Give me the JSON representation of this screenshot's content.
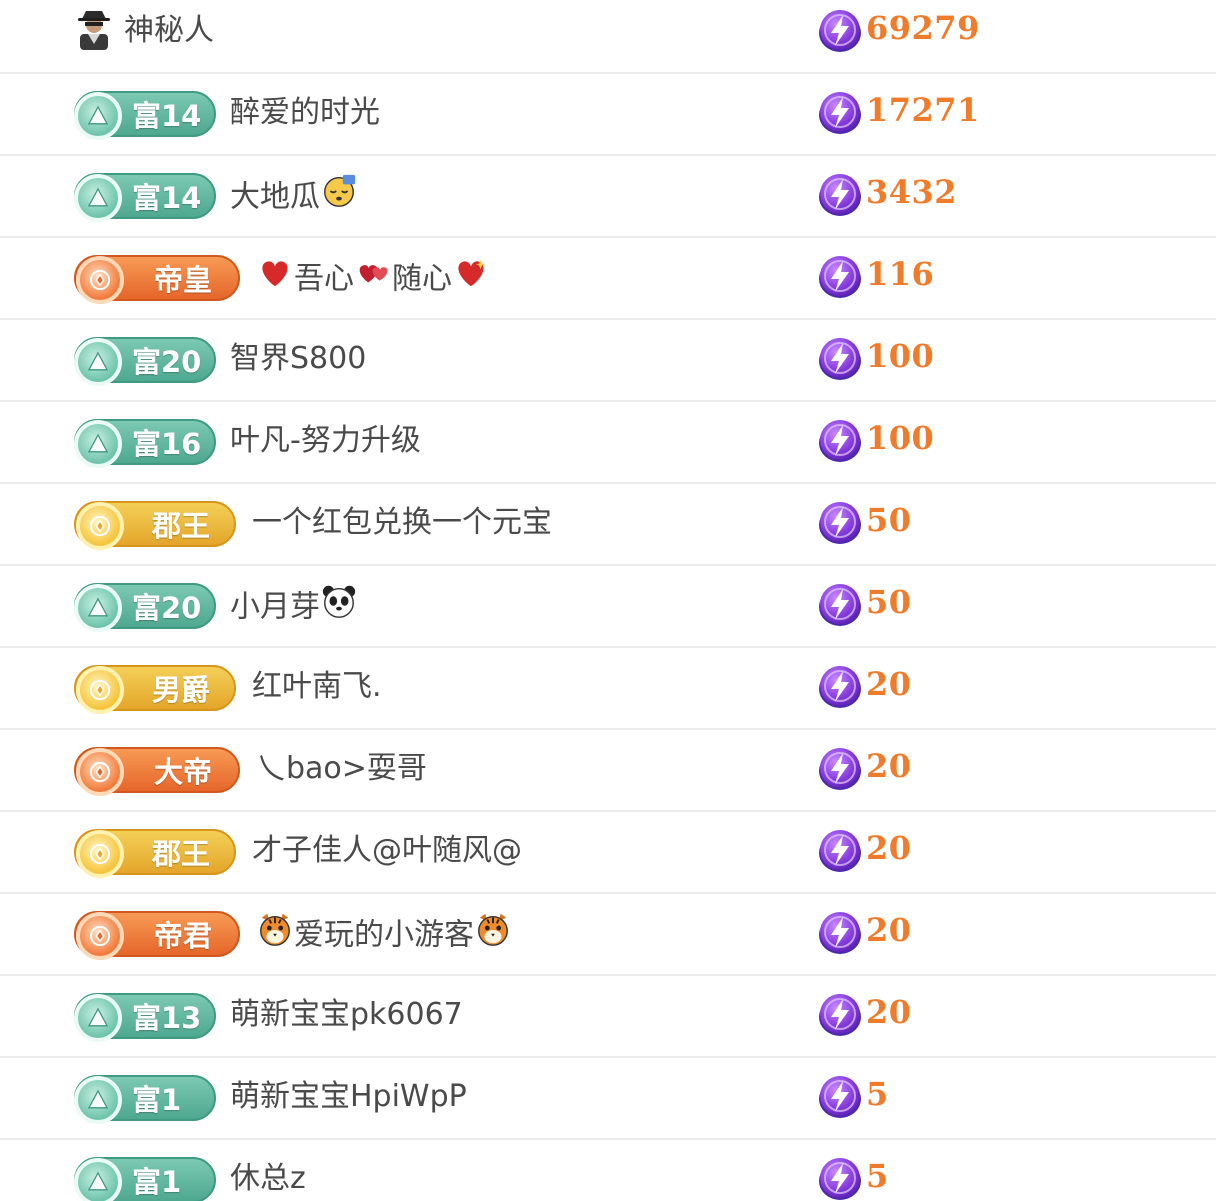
{
  "colors": {
    "amount": "#f07b2a",
    "name": "#4a4a4a",
    "rich_badge": "#5bb39a",
    "gold_badge": "#eab53a",
    "orange_badge": "#ec7234",
    "coin": "#8a3fe0",
    "divider": "#ededed"
  },
  "rows": [
    {
      "badge_type": "mystery",
      "badge_label": "",
      "badge_icon": "mystery-person-icon",
      "name": "神秘人",
      "emoji_suffix": "",
      "emoji_prefix": "",
      "amount": "69279"
    },
    {
      "badge_type": "rich",
      "badge_label": "富14",
      "badge_icon": "rich-level-icon",
      "name": "醉爱的时光",
      "emoji_suffix": "",
      "emoji_prefix": "",
      "amount": "17271"
    },
    {
      "badge_type": "rich",
      "badge_label": "富14",
      "badge_icon": "rich-level-icon",
      "name": "大地瓜",
      "emoji_suffix": "sleeping-face-icon",
      "emoji_prefix": "",
      "amount": "3432"
    },
    {
      "badge_type": "orange",
      "badge_label": "帝皇",
      "badge_icon": "noble-emperor-icon",
      "name": "吾心",
      "name2": "随心",
      "emoji_prefix": "red-heart-icon",
      "emoji_mid": "two-hearts-icon",
      "emoji_suffix": "sparkling-heart-icon",
      "amount": "116"
    },
    {
      "badge_type": "rich",
      "badge_label": "富20",
      "badge_icon": "rich-level-icon",
      "name": "智界S800",
      "emoji_suffix": "",
      "emoji_prefix": "",
      "amount": "100"
    },
    {
      "badge_type": "rich",
      "badge_label": "富16",
      "badge_icon": "rich-level-icon",
      "name": "叶凡-努力升级",
      "emoji_suffix": "",
      "emoji_prefix": "",
      "amount": "100"
    },
    {
      "badge_type": "gold",
      "badge_label": "郡王",
      "badge_icon": "noble-prince-icon",
      "name": "一个红包兑换一个元宝",
      "emoji_suffix": "",
      "emoji_prefix": "",
      "amount": "50"
    },
    {
      "badge_type": "rich",
      "badge_label": "富20",
      "badge_icon": "rich-level-icon",
      "name": "小月芽",
      "emoji_suffix": "panda-icon",
      "emoji_prefix": "",
      "amount": "50"
    },
    {
      "badge_type": "gold",
      "badge_label": "男爵",
      "badge_icon": "noble-baron-icon",
      "name": "红叶南飞.",
      "emoji_suffix": "",
      "emoji_prefix": "",
      "amount": "20"
    },
    {
      "badge_type": "orange",
      "badge_label": "大帝",
      "badge_icon": "noble-great-emperor-icon",
      "name": "乀bao>耍哥",
      "emoji_suffix": "",
      "emoji_prefix": "",
      "amount": "20"
    },
    {
      "badge_type": "gold",
      "badge_label": "郡王",
      "badge_icon": "noble-prince-icon",
      "name": "才子佳人@叶随风@",
      "emoji_suffix": "",
      "emoji_prefix": "",
      "amount": "20"
    },
    {
      "badge_type": "orange",
      "badge_label": "帝君",
      "badge_icon": "noble-sovereign-icon",
      "name": "爱玩的小游客",
      "emoji_suffix": "tiger-face-icon",
      "emoji_prefix": "tiger-face-icon",
      "amount": "20"
    },
    {
      "badge_type": "rich",
      "badge_label": "富13",
      "badge_icon": "rich-level-icon",
      "name": "萌新宝宝pk6067",
      "emoji_suffix": "",
      "emoji_prefix": "",
      "amount": "20"
    },
    {
      "badge_type": "rich",
      "badge_label": "富1",
      "badge_icon": "rich-level-icon",
      "name": "萌新宝宝HpiWpP",
      "emoji_suffix": "",
      "emoji_prefix": "",
      "amount": "5"
    },
    {
      "badge_type": "rich",
      "badge_label": "富1",
      "badge_icon": "rich-level-icon",
      "name": "休总z",
      "emoji_suffix": "",
      "emoji_prefix": "",
      "amount": "5"
    }
  ]
}
